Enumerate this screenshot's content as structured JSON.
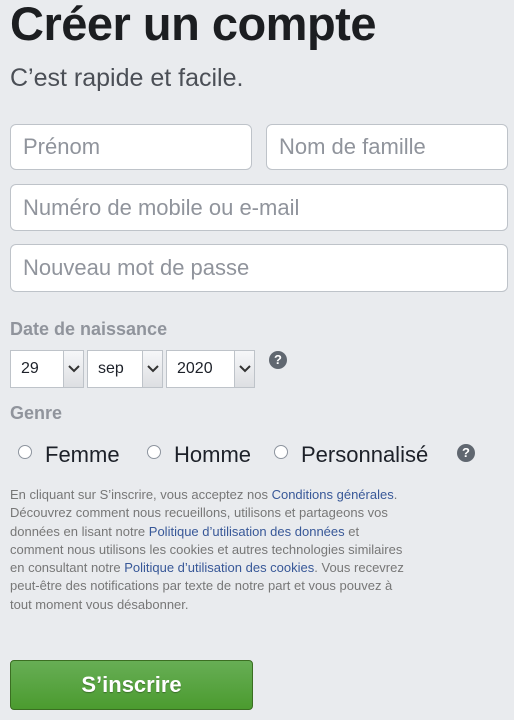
{
  "header": {
    "title": "Créer un compte",
    "subtitle": "C’est rapide et facile."
  },
  "form": {
    "firstname_placeholder": "Prénom",
    "lastname_placeholder": "Nom de famille",
    "contact_placeholder": "Numéro de mobile ou e-mail",
    "password_placeholder": "Nouveau mot de passe"
  },
  "birthday": {
    "label": "Date de naissance",
    "day": "29",
    "month": "sep",
    "year": "2020",
    "help_icon": "?"
  },
  "gender": {
    "label": "Genre",
    "options": [
      "Femme",
      "Homme",
      "Personnalisé"
    ],
    "help_icon": "?"
  },
  "terms": {
    "t1": "En cliquant sur S’inscrire, vous acceptez nos ",
    "link_conditions": "Conditions générales",
    "t2": ". Découvrez comment nous recueillons, utilisons et partageons vos données en lisant notre ",
    "link_data_policy": "Politique d’utilisation des données",
    "t3": " et comment nous utilisons les cookies et autres technologies similaires en consultant notre ",
    "link_cookies_policy": "Politique d’utilisation des cookies",
    "t4": ". Vous recevrez peut-être des notifications par texte de notre part et vous pouvez à tout moment vous désabonner."
  },
  "submit": {
    "label": "S’inscrire"
  },
  "colors": {
    "background": "#e9ebee",
    "link": "#385898",
    "submit_green": "#4b9b2f"
  }
}
